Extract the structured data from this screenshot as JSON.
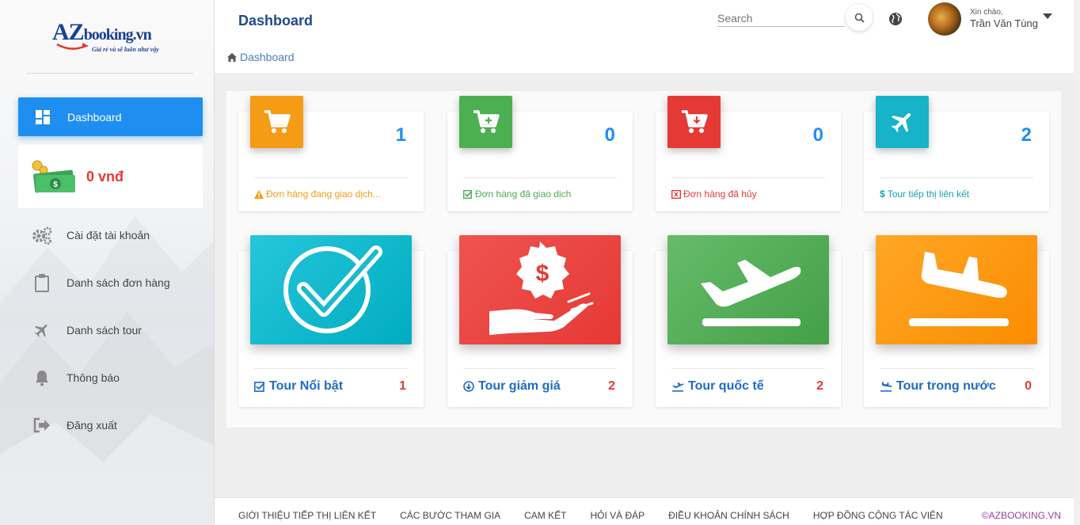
{
  "brand": {
    "name_big": "AZ",
    "name_rest": "booking.vn",
    "tagline": "Giá rẻ và sẽ luôn như vậy"
  },
  "sidebar": {
    "active": {
      "label": "Dashboard",
      "icon": "dashboard-icon"
    },
    "wallet": {
      "amount": "0 vnđ",
      "icon": "money-icon"
    },
    "items": [
      {
        "label": "Cài đặt tài khoản",
        "icon": "gears-icon"
      },
      {
        "label": "Danh sách đơn hàng",
        "icon": "clipboard-icon"
      },
      {
        "label": "Danh sách tour",
        "icon": "plane-icon"
      },
      {
        "label": "Thông báo",
        "icon": "bell-icon"
      },
      {
        "label": "Đăng xuất",
        "icon": "logout-icon"
      }
    ]
  },
  "header": {
    "title": "Dashboard",
    "breadcrumb": "Dashboard",
    "search_placeholder": "Search",
    "greeting": "Xin chào,",
    "username": "Trần Văn Tùng"
  },
  "stats": [
    {
      "value": "1",
      "label": "Đơn hàng đang giao dịch...",
      "color": "#f39c12",
      "icon": "cart-icon",
      "label_color": "#f39c12"
    },
    {
      "value": "0",
      "label": "Đơn hàng đã giao dịch",
      "color": "#4caf50",
      "icon": "cart-plus-icon",
      "label_color": "#4caf50"
    },
    {
      "value": "0",
      "label": "Đơn hàng đã hủy",
      "color": "#e53935",
      "icon": "cart-download-icon",
      "label_color": "#e53935"
    },
    {
      "value": "2",
      "label": "Tour tiếp thị liên kết",
      "color": "#17b3c8",
      "icon": "plane-icon",
      "label_color": "#17a2b8"
    }
  ],
  "tours": [
    {
      "label": "Tour Nổi bật",
      "count": "1",
      "icon": "check-circle-icon"
    },
    {
      "label": "Tour giảm giá",
      "count": "2",
      "icon": "dollar-hand-icon"
    },
    {
      "label": "Tour quốc tế",
      "count": "2",
      "icon": "plane-departure-icon"
    },
    {
      "label": "Tour trong nước",
      "count": "0",
      "icon": "plane-arrival-icon"
    }
  ],
  "footer": {
    "links": [
      "GIỚI THIỆU TIẾP THỊ LIÊN KẾT",
      "CÁC BƯỚC THAM GIA",
      "CAM KẾT",
      "HỎI VÀ ĐÁP",
      "ĐIỀU KHOẢN CHÍNH SÁCH",
      "HỢP ĐỒNG CỘNG TÁC VIÊN"
    ],
    "copyright": "©AZBOOKING.VN"
  }
}
